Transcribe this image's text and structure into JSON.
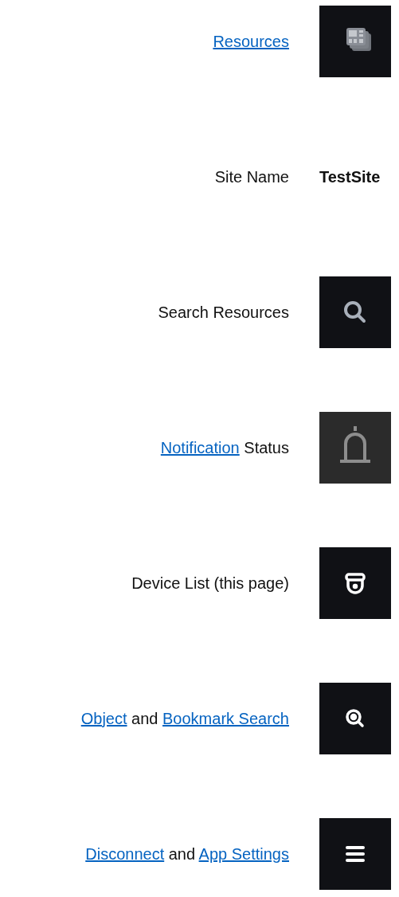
{
  "rows": [
    {
      "kind": "icon",
      "label": [
        {
          "text": "Resources",
          "link": true
        }
      ]
    },
    {
      "kind": "value",
      "label": [
        {
          "text": "Site Name",
          "link": false
        }
      ],
      "value": "TestSite"
    },
    {
      "kind": "icon",
      "label": [
        {
          "text": "Search Resources",
          "link": false
        }
      ]
    },
    {
      "kind": "icon",
      "label": [
        {
          "text": "Notification",
          "link": true
        },
        {
          "text": " Status",
          "link": false
        }
      ]
    },
    {
      "kind": "icon",
      "label": [
        {
          "text": "Device List (this page)",
          "link": false
        }
      ]
    },
    {
      "kind": "icon",
      "label": [
        {
          "text": "Object",
          "link": true
        },
        {
          "text": " and ",
          "link": false
        },
        {
          "text": "Bookmark Search",
          "link": true
        }
      ]
    },
    {
      "kind": "icon",
      "label": [
        {
          "text": "Disconnect",
          "link": true
        },
        {
          "text": " and ",
          "link": false
        },
        {
          "text": "App Settings",
          "link": true
        }
      ]
    }
  ]
}
